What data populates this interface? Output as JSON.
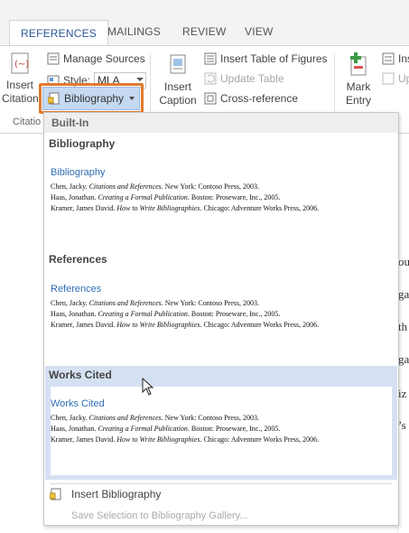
{
  "tabs": [
    "REFERENCES",
    "MAILINGS",
    "REVIEW",
    "VIEW"
  ],
  "ribbon": {
    "insert_citation": [
      "Insert",
      "Citation"
    ],
    "manage_sources": "Manage Sources",
    "style_label": "Style:",
    "style_value": "MLA",
    "bibliography_button": "Bibliography",
    "group_citations": "Citatio",
    "insert_caption": [
      "Insert",
      "Caption"
    ],
    "insert_table_of_figures": "Insert Table of Figures",
    "update_table": "Update Table",
    "cross_reference": "Cross-reference",
    "mark_entry": [
      "Mark",
      "Entry"
    ],
    "insert_index": "Ins",
    "update_index": "Up"
  },
  "panel": {
    "header": "Built-In",
    "sections": [
      {
        "title": "Bibliography",
        "heading": "Bibliography",
        "entries": [
          {
            "pre": "Chen, Jacky. ",
            "ital": "Citations and References",
            "post": ". New York: Contoso Press, 2003."
          },
          {
            "pre": "Haas, Jonathan. ",
            "ital": "Creating a Formal Publication",
            "post": ". Boston: Proseware, Inc., 2005."
          },
          {
            "pre": "Kramer, James David. ",
            "ital": "How to Write Bibliographies",
            "post": ". Chicago: Adventure  Works Press, 2006."
          }
        ]
      },
      {
        "title": "References",
        "heading": "References",
        "entries": [
          {
            "pre": "Chen, Jacky. ",
            "ital": "Citations and References",
            "post": ". New York: Contoso Press, 2003."
          },
          {
            "pre": "Haas, Jonathan. ",
            "ital": "Creating a Formal Publication",
            "post": ". Boston: Proseware, Inc., 2005."
          },
          {
            "pre": "Kramer, James David. ",
            "ital": "How to Write Bibliographies",
            "post": ". Chicago: Adventure  Works Press, 2006."
          }
        ]
      },
      {
        "title": "Works Cited",
        "heading": "Works Cited",
        "entries": [
          {
            "pre": "Chen, Jacky. ",
            "ital": "Citations and References",
            "post": ". New York: Contoso Press, 2003."
          },
          {
            "pre": "Haas, Jonathan. ",
            "ital": "Creating a Formal Publication",
            "post": ". Boston: Proseware, Inc., 2005."
          },
          {
            "pre": "Kramer, James David. ",
            "ital": "How to Write Bibliographies",
            "post": ". Chicago: Adventure  Works Press, 2006."
          }
        ]
      }
    ],
    "insert_bibliography": "Insert Bibliography",
    "save_selection": "Save Selection to Bibliography Gallery..."
  },
  "document_fragments": [
    "ou",
    "ga",
    "th",
    "ga",
    "iz",
    "’s"
  ],
  "colors": {
    "accent": "#2b579a",
    "highlight_box": "#e07a2e",
    "selected_band": "#d5e1f2",
    "heading_blue": "#2f6db5"
  }
}
